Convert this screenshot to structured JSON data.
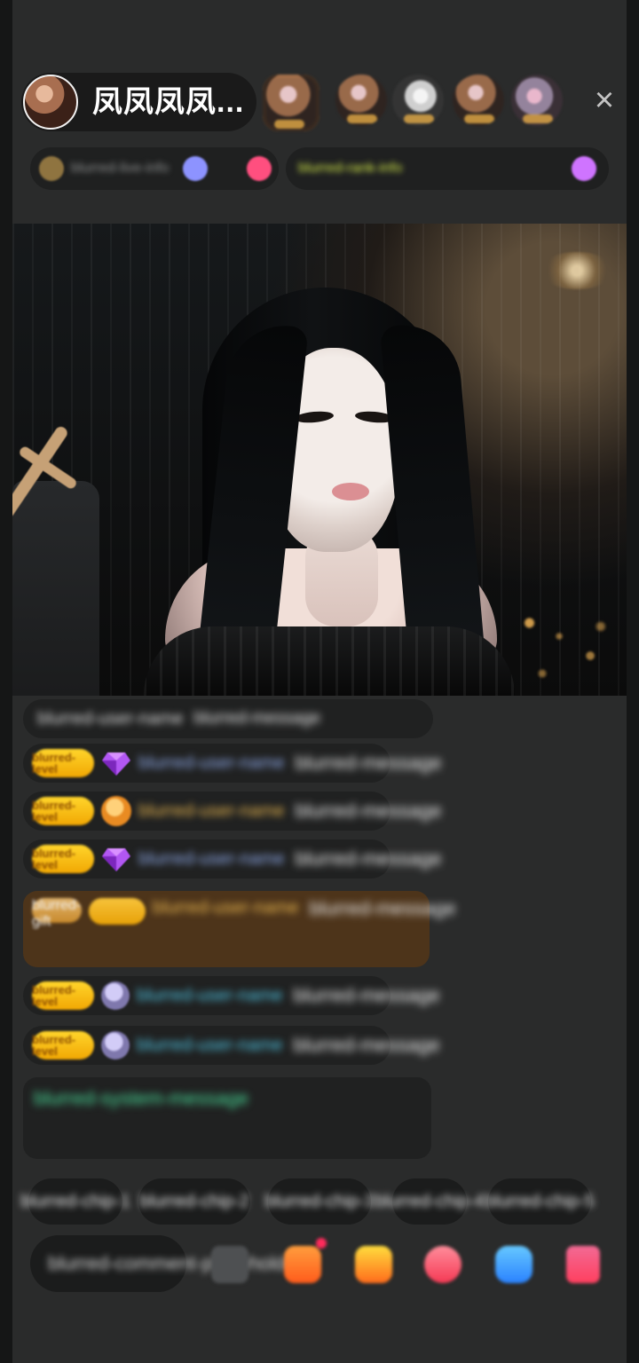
{
  "host": {
    "name": "凤凤凤凤..."
  },
  "top_bar": {
    "viewer_avatars": [
      {
        "name": "top-viewer-avatar"
      },
      {
        "name": "viewer-avatar-2"
      },
      {
        "name": "viewer-avatar-3"
      },
      {
        "name": "viewer-avatar-4"
      },
      {
        "name": "viewer-avatar-5"
      }
    ],
    "close_icon": "close-icon"
  },
  "colors": {
    "background": "#2a2b2b",
    "dark_pill": "#1b1c1c",
    "gold_badge": "#f4b01b",
    "green_message": "#49df9a",
    "chat_highlight": "#503519"
  },
  "info": {
    "left_text": "blurred-live-info",
    "right_text": "blurred-rank-info"
  },
  "chat": {
    "messages": [
      {
        "badge": "",
        "icon": "",
        "name": "blurred-user-name",
        "text": "blurred-message"
      },
      {
        "badge": "blurred-level",
        "icon": "gem-icon",
        "name": "blurred-user-name",
        "text": "blurred-message"
      },
      {
        "badge": "blurred-level",
        "icon": "orange-gift-icon",
        "name": "blurred-user-name",
        "text": "blurred-message"
      },
      {
        "badge": "blurred-level",
        "icon": "gem-icon",
        "name": "blurred-user-name",
        "text": "blurred-message"
      },
      {
        "badge": "blurred-gift",
        "icon": "",
        "name": "blurred-user-name",
        "text": "blurred-message"
      },
      {
        "badge": "blurred-level",
        "icon": "purple-user-icon",
        "name": "blurred-user-name",
        "text": "blurred-message"
      },
      {
        "badge": "blurred-level",
        "icon": "purple-user-icon",
        "name": "blurred-user-name",
        "text": "blurred-message"
      }
    ],
    "system_message": "blurred-system-message"
  },
  "quick_actions": [
    "blurred-chip-1",
    "blurred-chip-2",
    "blurred-chip-3",
    "blurred-chip-4",
    "blurred-chip-5"
  ],
  "bottom": {
    "comment_placeholder": "blurred-comment-placeholder"
  },
  "icons": {
    "emoji": "emoji-icon",
    "gift": "gift-icon",
    "bag": "bag-icon",
    "heart": "heart-icon",
    "share": "share-icon",
    "more": "more-icon"
  }
}
